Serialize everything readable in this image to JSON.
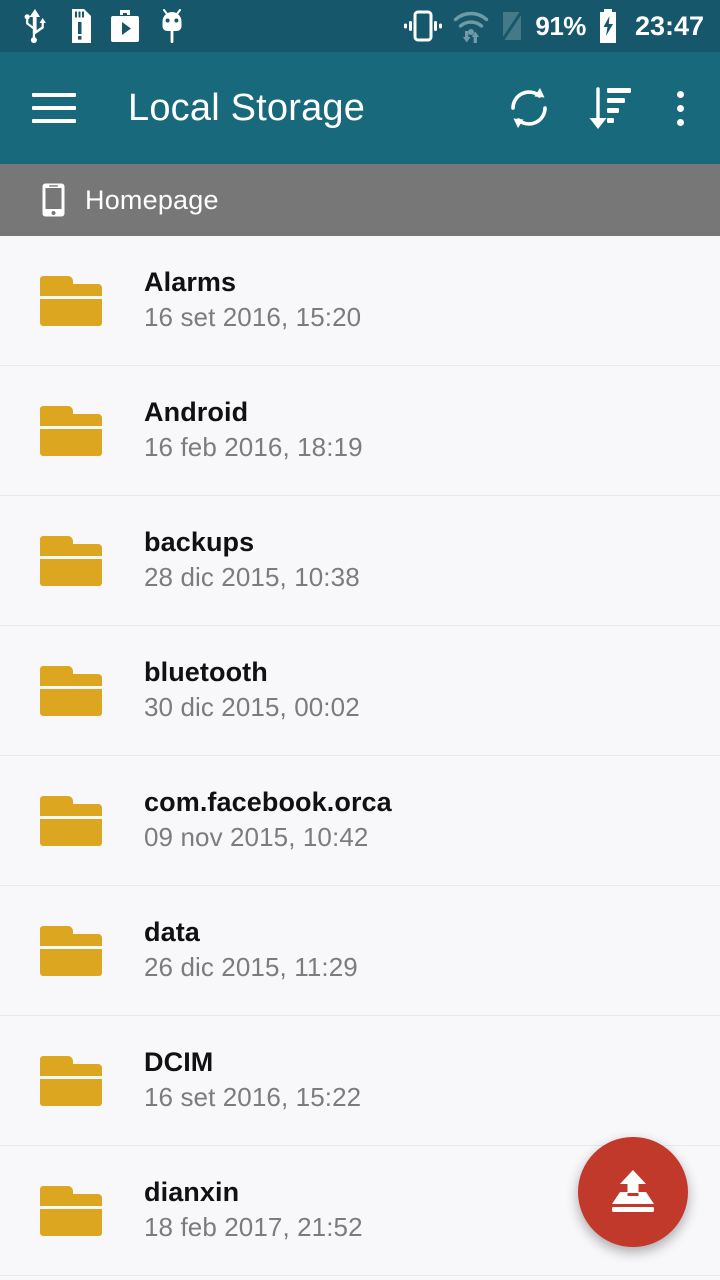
{
  "status_bar": {
    "left_icons": [
      "usb-icon",
      "sdcard-alert-icon",
      "play-store-icon",
      "android-bug-icon"
    ],
    "right_icons": [
      "vibrate-icon",
      "wifi-data-icon",
      "signal-off-icon"
    ],
    "battery_percent": "91%",
    "battery_icon": "battery-charging-icon",
    "clock": "23:47",
    "background_color": "#17576B"
  },
  "app_bar": {
    "title": "Local Storage",
    "menu_icon": "hamburger-menu-icon",
    "actions": [
      {
        "name": "refresh",
        "icon": "refresh-icon"
      },
      {
        "name": "sort",
        "icon": "sort-descending-icon"
      },
      {
        "name": "overflow",
        "icon": "more-vertical-icon"
      }
    ],
    "background_color": "#19697C"
  },
  "breadcrumb": {
    "icon": "phone-icon",
    "label": "Homepage",
    "background_color": "#777777"
  },
  "file_list": {
    "items": [
      {
        "icon": "folder-icon",
        "name": "Alarms",
        "date": "16 set 2016, 15:20"
      },
      {
        "icon": "folder-icon",
        "name": "Android",
        "date": "16 feb 2016, 18:19"
      },
      {
        "icon": "folder-icon",
        "name": "backups",
        "date": "28 dic 2015, 10:38"
      },
      {
        "icon": "folder-icon",
        "name": "bluetooth",
        "date": "30 dic 2015, 00:02"
      },
      {
        "icon": "folder-icon",
        "name": "com.facebook.orca",
        "date": "09 nov 2015, 10:42"
      },
      {
        "icon": "folder-icon",
        "name": "data",
        "date": "26 dic 2015, 11:29"
      },
      {
        "icon": "folder-icon",
        "name": "DCIM",
        "date": "16 set 2016, 15:22"
      },
      {
        "icon": "folder-icon",
        "name": "dianxin",
        "date": "18 feb 2017, 21:52"
      }
    ],
    "folder_color": "#DCA621",
    "background_color": "#F8F7FA"
  },
  "fab": {
    "icon": "upload-icon",
    "color": "#C0392B"
  }
}
